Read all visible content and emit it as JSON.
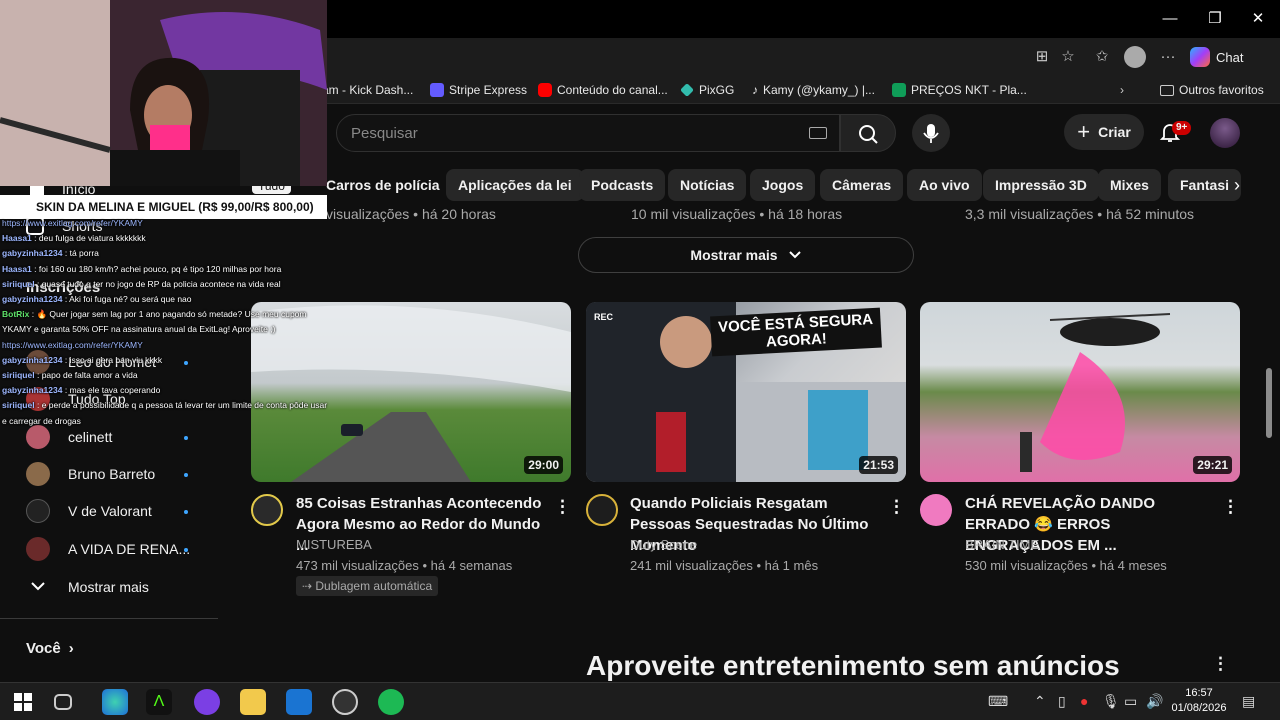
{
  "window": {
    "minimize": "—",
    "maximize": "❐",
    "close": "✕"
  },
  "browser": {
    "chat_label": "Chat"
  },
  "bookmarks": [
    {
      "label": "am - Kick Dash...",
      "icon": "kick-icon",
      "color": "#53fc18"
    },
    {
      "label": "Stripe Express",
      "icon": "stripe-icon",
      "color": "#635bff"
    },
    {
      "label": "Conteúdo do canal...",
      "icon": "youtube-icon",
      "color": "#ff0000"
    },
    {
      "label": "PixGG",
      "icon": "pixgg-icon",
      "color": "#32bcad"
    },
    {
      "label": "Kamy (@ykamy_) |...",
      "icon": "tiktok-icon",
      "color": "#ffffff"
    },
    {
      "label": "PREÇOS NKT - Pla...",
      "icon": "sheets-icon",
      "color": "#0f9d58"
    }
  ],
  "other_favorites": "Outros favoritos",
  "youtube": {
    "search_placeholder": "Pesquisar",
    "create_label": "Criar",
    "notif_badge": "9+",
    "chips": [
      "Carros de polícia",
      "Aplicações da lei",
      "Podcasts",
      "Notícias",
      "Jogos",
      "Câmeras",
      "Ao vivo",
      "Impressão 3D",
      "Mixes",
      "Fantasi"
    ],
    "prev_row_meta": [
      "visualizações • há 20 horas",
      "10 mil visualizações • há 18 horas",
      "3,3 mil visualizações • há 52 minutos"
    ],
    "show_more": "Mostrar mais",
    "videos": [
      {
        "title": "85 Coisas Estranhas Acontecendo Agora Mesmo ao Redor do Mundo ...",
        "channel": "MISTUREBA",
        "meta": "473 mil visualizações • há 4 semanas",
        "duration": "29:00",
        "badge": "Dublagem automática"
      },
      {
        "title": "Quando Policiais Resgatam Pessoas Sequestradas No Último Momento",
        "channel": "Duty Scene",
        "meta": "241 mil visualizações • há 1 mês",
        "duration": "21:53",
        "thumb_text": "VOCÊ ESTÁ SEGURA AGORA!",
        "rec": "REC"
      },
      {
        "title": "CHÁ REVELAÇÃO DANDO ERRADO 😂 ERROS ENGRAÇADOS EM ...",
        "channel": "BRAIN TIME",
        "meta": "530 mil visualizações • há 4 meses",
        "duration": "29:21"
      }
    ],
    "promo_title": "Aproveite entretenimento sem anúncios"
  },
  "sidebar": {
    "home": "Início",
    "shorts": "Shorts",
    "subscriptions": "Inscrições",
    "tudo": "Tudo",
    "subs": [
      {
        "name": "Leo do Homet",
        "color": "#6b4b3a"
      },
      {
        "name": "Tudo Top",
        "color": "#aa3333"
      },
      {
        "name": "celinett",
        "color": "#b85a6a"
      },
      {
        "name": "Bruno Barreto",
        "color": "#8a6a4a"
      },
      {
        "name": "V de Valorant",
        "color": "#222222"
      },
      {
        "name": "A VIDA DE RENA...",
        "color": "#6a2a2a"
      }
    ],
    "show_more": "Mostrar mais",
    "you": "Você"
  },
  "stream": {
    "goal": "SKIN DA MELINA E MIGUEL (R$ 99,00/R$ 800,00)",
    "chat": [
      {
        "user": "",
        "text": "https://www.exitlag.com/refer/YKAMY",
        "link": true
      },
      {
        "user": "Haasa1",
        "text": ": deu fulga de viatura kkkkkkk"
      },
      {
        "user": "gabyzinha1234",
        "text": ": tá porra"
      },
      {
        "user": "Haasa1",
        "text": ": foi 160 ou 180 km/h? achei pouco, pq é tipo 120 milhas por hora"
      },
      {
        "user": "siriiquel",
        "text": ": quase tudo q ter no jogo de RP da policia acontece na vida real"
      },
      {
        "user": "gabyzinha1234",
        "text": ": Aki foi fuga né? ou será que nao"
      },
      {
        "user": "BotRix",
        "text": ": 🔥 Quer jogar sem lag por 1 ano pagando só metade? Use meu cupom YKAMY e garanta 50% OFF na assinatura anual da ExitLag! Aproveite ;)",
        "bot": true
      },
      {
        "user": "",
        "text": "https://www.exitlag.com/refer/YKAMY",
        "link": true
      },
      {
        "user": "gabyzinha1234",
        "text": ": isso ai gera ban viu kkkk"
      },
      {
        "user": "siriiquel",
        "text": ": papo de falta amor a vida"
      },
      {
        "user": "gabyzinha1234",
        "text": ": mas ele tava coperando"
      },
      {
        "user": "siriiquel",
        "text": ": e perde a possibilidade q a pessoa tá levar ter um limite de conta pôde usar e carregar de drogas"
      }
    ]
  },
  "taskbar": {
    "time": "16:57",
    "date": "01/08/2026"
  }
}
